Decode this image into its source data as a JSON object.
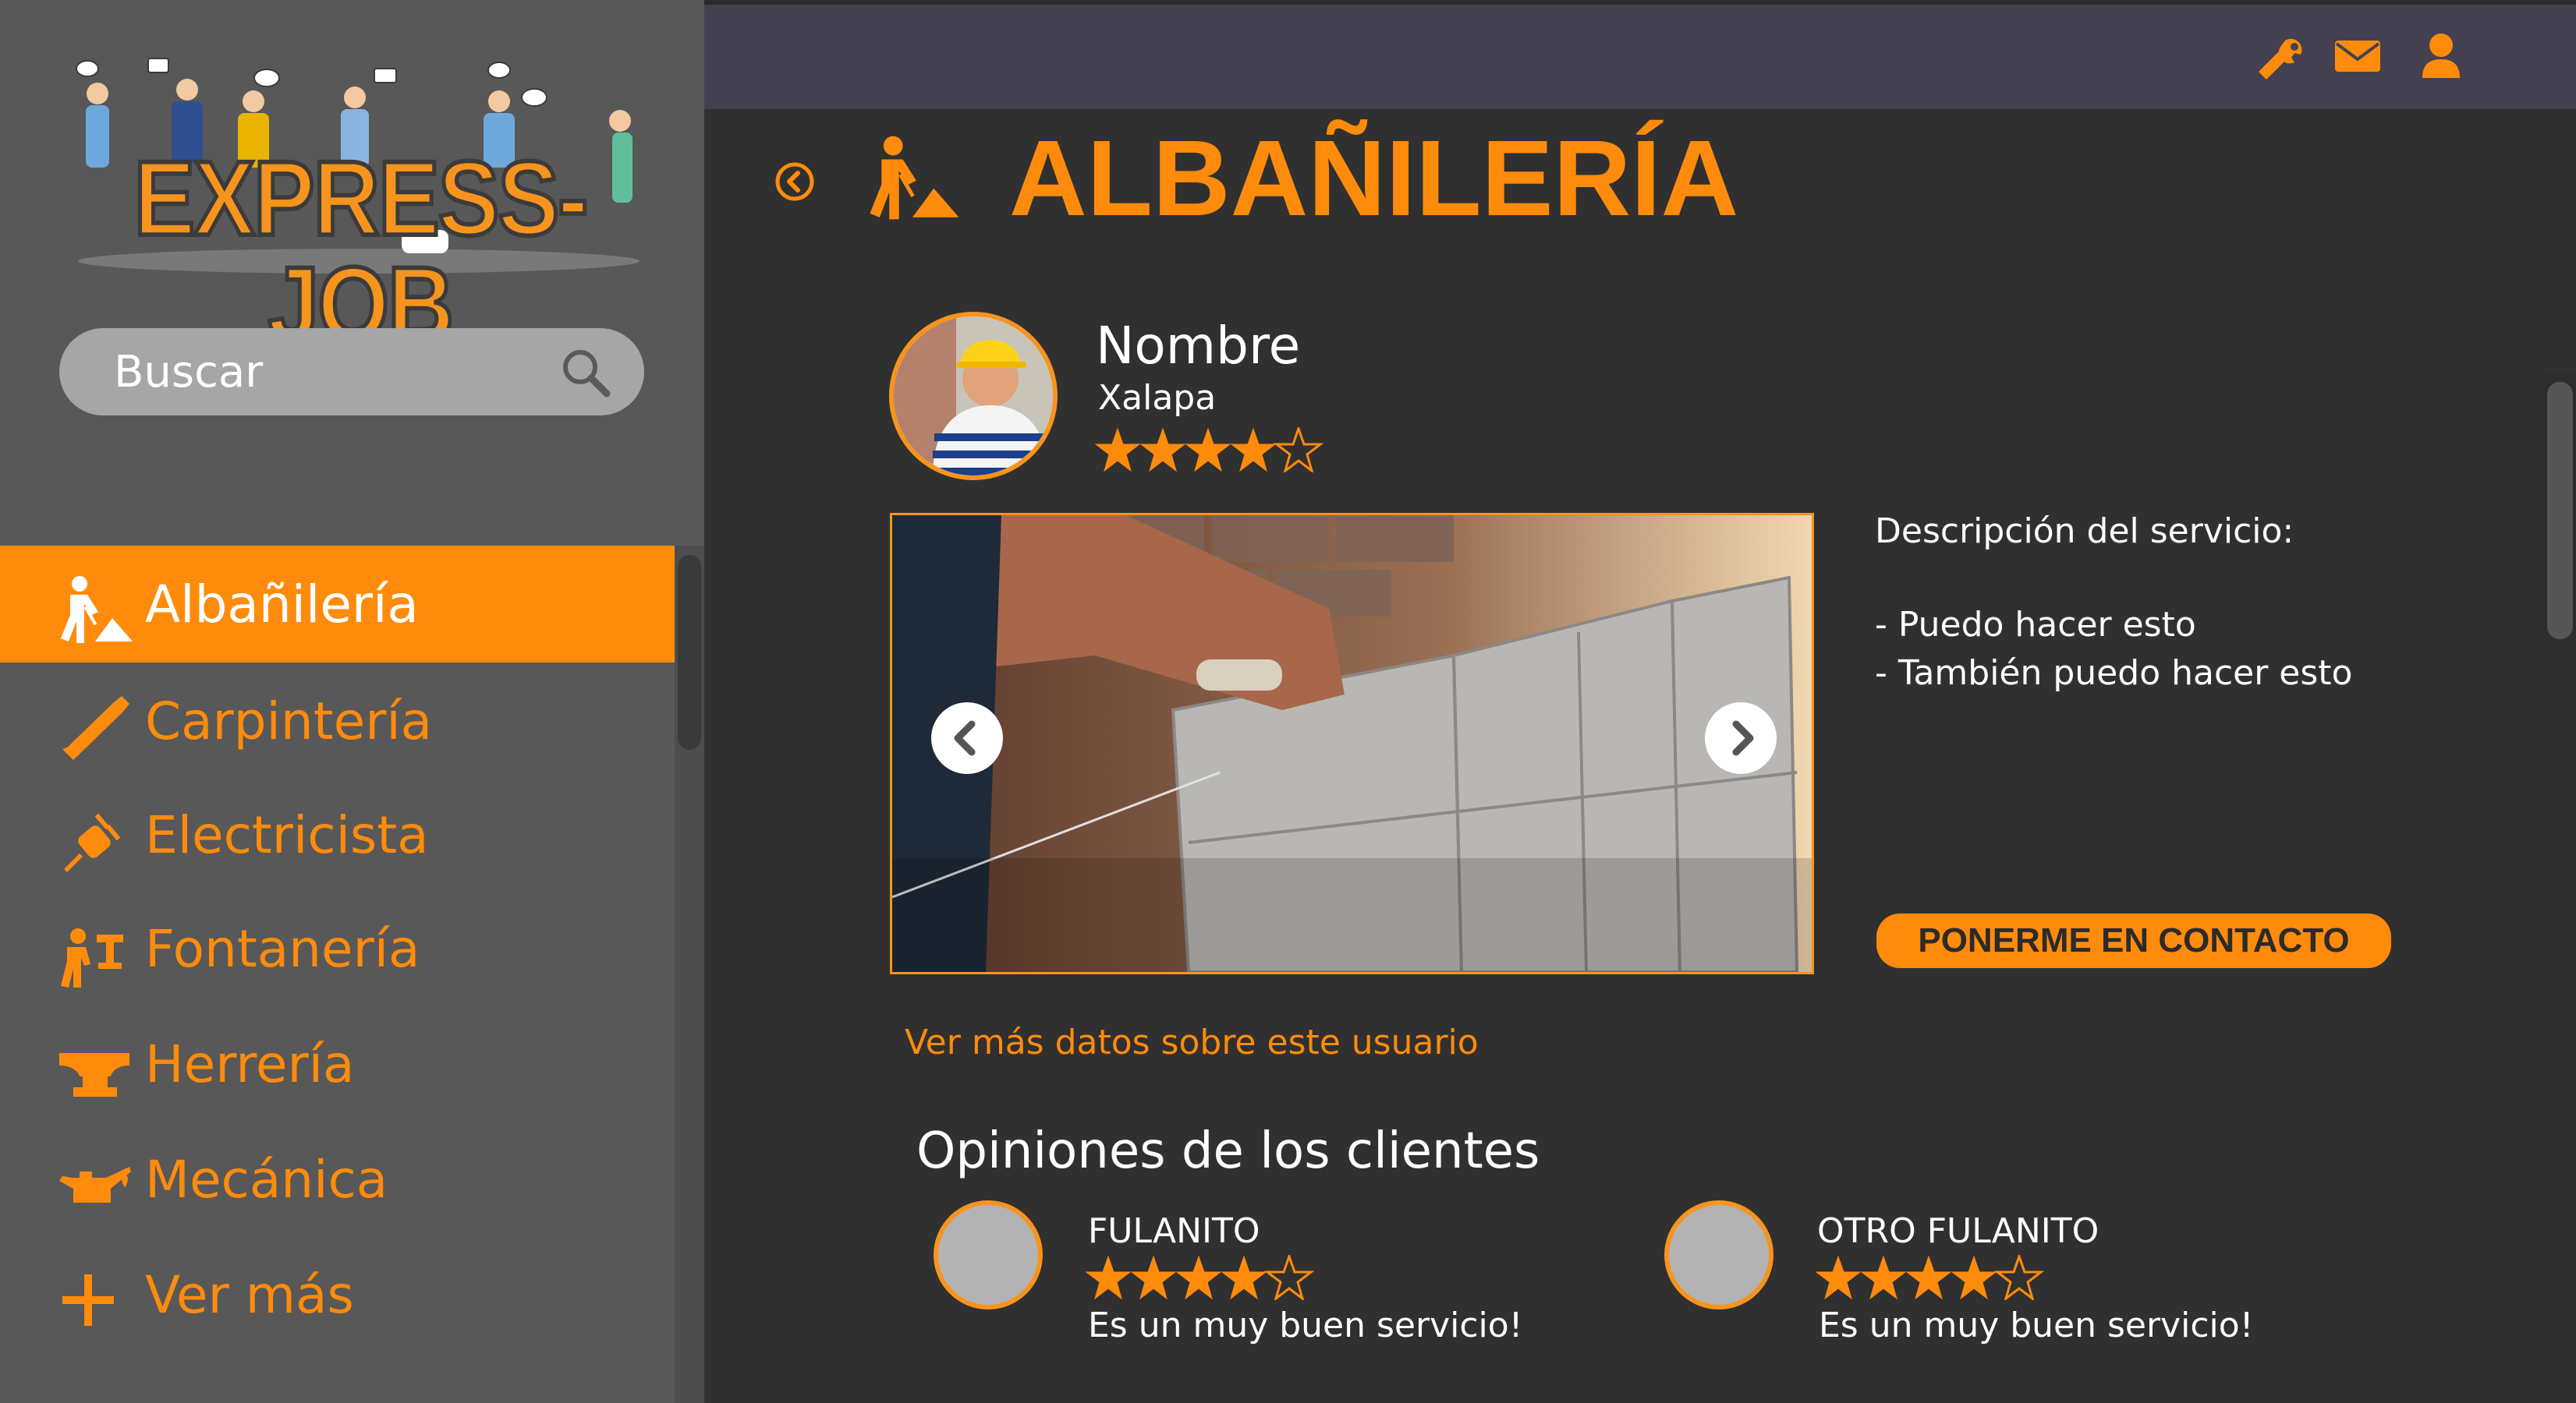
{
  "brand": {
    "logo_text": "EXPRESS-JOB",
    "accent_color": "#ff8b0c"
  },
  "sidebar": {
    "search": {
      "placeholder": "Buscar"
    },
    "items": [
      {
        "label": "Albañilería",
        "icon": "mason-worker-icon",
        "active": true
      },
      {
        "label": "Carpintería",
        "icon": "handsaw-icon",
        "active": false
      },
      {
        "label": "Electricista",
        "icon": "electric-plug-icon",
        "active": false
      },
      {
        "label": "Fontanería",
        "icon": "plumber-icon",
        "active": false
      },
      {
        "label": "Herrería",
        "icon": "anvil-icon",
        "active": false
      },
      {
        "label": "Mecánica",
        "icon": "oil-can-icon",
        "active": false
      },
      {
        "label": "Ver más",
        "icon": "plus-icon",
        "active": false
      }
    ]
  },
  "topbar": {
    "icons": [
      "tools-icon",
      "mail-icon",
      "user-icon"
    ]
  },
  "page": {
    "title": "ALBAÑILERÍA",
    "title_icon": "mason-worker-icon",
    "back_icon": "back-arrow-icon"
  },
  "provider": {
    "name": "Nombre",
    "city": "Xalapa",
    "rating": 4,
    "rating_max": 5
  },
  "service": {
    "description_title": "Descripción del servicio:",
    "lines": [
      "- Puedo hacer esto",
      "- También puedo hacer esto"
    ],
    "contact_button": "PONERME EN CONTACTO",
    "more_link": "Ver más datos sobre este usuario"
  },
  "reviews": {
    "title": "Opiniones de los clientes",
    "items": [
      {
        "name": "FULANITO",
        "rating": 4,
        "text": "Es un muy buen servicio!"
      },
      {
        "name": "OTRO FULANITO",
        "rating": 4,
        "text": "Es un muy buen servicio!"
      }
    ]
  }
}
